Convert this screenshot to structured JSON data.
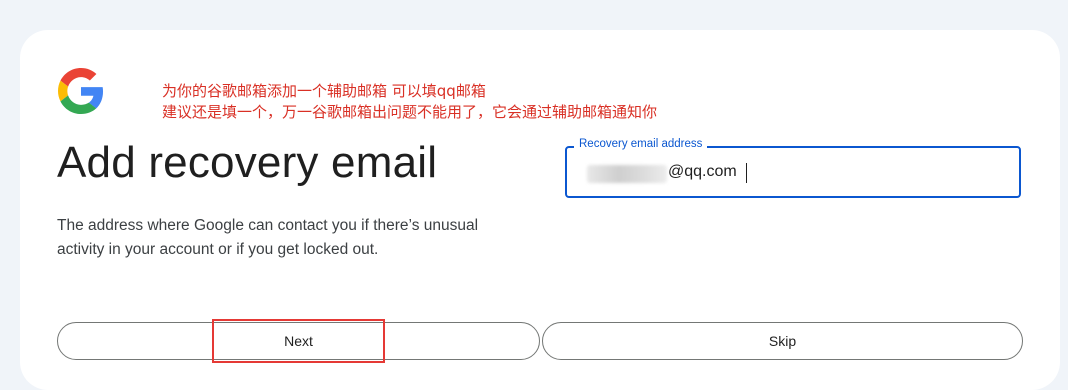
{
  "annotation": {
    "line1": "为你的谷歌邮箱添加一个辅助邮箱 可以填qq邮箱",
    "line2": "建议还是填一个，万一谷歌邮箱出问题不能用了，它会通过辅助邮箱通知你",
    "color": "#d93025"
  },
  "page": {
    "title": "Add recovery email",
    "description": "The address where Google can contact you if there’s unusual activity in your account or if you get locked out."
  },
  "recovery_field": {
    "label": "Recovery email address",
    "value_suffix": "@qq.com",
    "accent": "#0b57d0"
  },
  "buttons": {
    "next_label": "Next",
    "skip_label": "Skip"
  },
  "icons": {
    "logo": "google-g-icon"
  }
}
